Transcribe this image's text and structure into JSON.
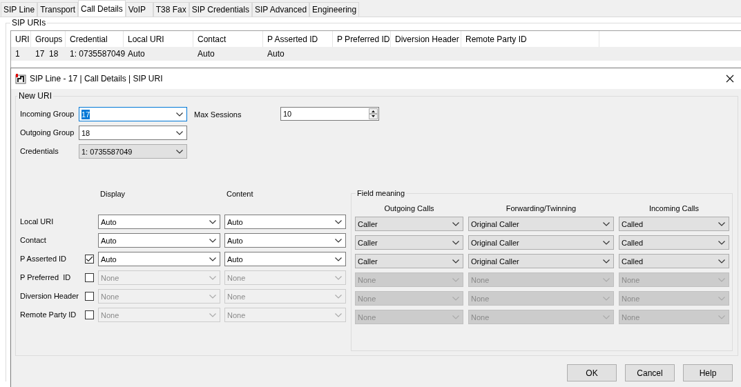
{
  "tabs": [
    {
      "label": "SIP Line",
      "selected": false
    },
    {
      "label": "Transport",
      "selected": false
    },
    {
      "label": "Call Details",
      "selected": true
    },
    {
      "label": "VoIP",
      "selected": false
    },
    {
      "label": "T38 Fax",
      "selected": false
    },
    {
      "label": "SIP Credentials",
      "selected": false
    },
    {
      "label": "SIP Advanced",
      "selected": false
    },
    {
      "label": "Engineering",
      "selected": false
    }
  ],
  "sip_uris": {
    "title": "SIP URIs",
    "columns": [
      "URI",
      "Groups",
      "Credential",
      "Local URI",
      "Contact",
      "P Asserted ID",
      "P Preferred ID",
      "Diversion Header",
      "Remote Party ID"
    ],
    "rows": [
      {
        "cells": [
          "1",
          "17  18",
          "1: 0735587049",
          "Auto",
          "Auto",
          "Auto"
        ],
        "selected": true
      }
    ]
  },
  "dialog": {
    "title": "SIP Line - 17 | Call Details | SIP URI",
    "group_title": "New URI",
    "fields": [
      {
        "label": "Incoming Group",
        "value": "17",
        "kind": "combo",
        "focused": true
      },
      {
        "label": "Outgoing Group",
        "value": "18",
        "kind": "combo",
        "focused": false
      },
      {
        "label": "Credentials",
        "value": "1: 0735587049",
        "kind": "list",
        "focused": false
      }
    ],
    "max_sessions": {
      "label": "Max Sessions",
      "value": "10"
    },
    "display_heading": "Display",
    "content_heading": "Content",
    "field_meaning": {
      "title": "Field meaning",
      "columns": [
        "Outgoing Calls",
        "Forwarding/Twinning",
        "Incoming Calls"
      ]
    },
    "headers": [
      {
        "label": "Local URI",
        "enabled": true,
        "display": "Auto",
        "content": "Auto",
        "outgoing": "Caller",
        "forwarding": "Original Caller",
        "incoming": "Called"
      },
      {
        "label": "Contact",
        "enabled": true,
        "display": "Auto",
        "content": "Auto",
        "outgoing": "Caller",
        "forwarding": "Original Caller",
        "incoming": "Called"
      },
      {
        "label": "P Asserted ID",
        "checked": true,
        "enabled": true,
        "display": "Auto",
        "content": "Auto",
        "outgoing": "Caller",
        "forwarding": "Original Caller",
        "incoming": "Called"
      },
      {
        "label": "P Preferred  ID",
        "checked": false,
        "enabled": false,
        "display": "None",
        "content": "None",
        "outgoing": "None",
        "forwarding": "None",
        "incoming": "None"
      },
      {
        "label": "Diversion Header",
        "checked": false,
        "enabled": false,
        "display": "None",
        "content": "None",
        "outgoing": "None",
        "forwarding": "None",
        "incoming": "None"
      },
      {
        "label": "Remote Party ID",
        "checked": false,
        "enabled": false,
        "display": "None",
        "content": "None",
        "outgoing": "None",
        "forwarding": "None",
        "incoming": "None"
      }
    ],
    "buttons": [
      "OK",
      "Cancel",
      "Help"
    ]
  }
}
